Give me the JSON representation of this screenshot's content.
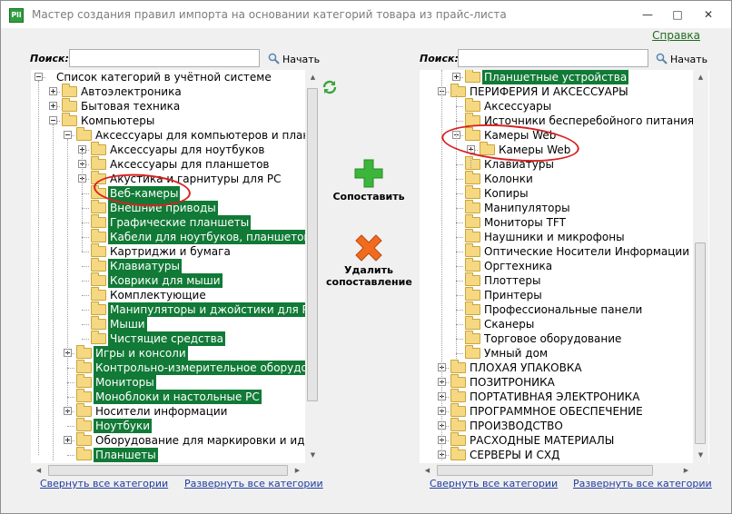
{
  "window": {
    "title": "Мастер создания правил импорта на основании категорий товара из прайс-листа",
    "icon_text": "Pli",
    "help_label": "Справка"
  },
  "left": {
    "search_label": "Поиск:",
    "search_value": "",
    "start_label": "Начать",
    "collapse_label": "Свернуть все категории",
    "expand_label": "Развернуть все категории",
    "rows": [
      {
        "label": "Список категорий в учётной системе",
        "level": 0,
        "exp": "minus",
        "folder": false,
        "hl": false
      },
      {
        "label": "Автоэлектроника",
        "level": 1,
        "exp": "plus",
        "folder": true,
        "hl": false
      },
      {
        "label": "Бытовая техника",
        "level": 1,
        "exp": "plus",
        "folder": true,
        "hl": false
      },
      {
        "label": "Компьютеры",
        "level": 1,
        "exp": "minus",
        "folder": true,
        "hl": false
      },
      {
        "label": "Аксессуары для компьютеров и планшетов",
        "level": 2,
        "exp": "minus",
        "folder": true,
        "hl": false
      },
      {
        "label": "Аксессуары для ноутбуков",
        "level": 3,
        "exp": "plus",
        "folder": true,
        "hl": false
      },
      {
        "label": "Аксессуары для планшетов",
        "level": 3,
        "exp": "plus",
        "folder": true,
        "hl": false
      },
      {
        "label": "Акустика и гарнитуры для РС",
        "level": 3,
        "exp": "plus",
        "folder": true,
        "hl": false
      },
      {
        "label": "Веб-камеры",
        "level": 3,
        "exp": "",
        "folder": true,
        "hl": true
      },
      {
        "label": "Внешние приводы",
        "level": 3,
        "exp": "",
        "folder": true,
        "hl": true
      },
      {
        "label": "Графические планшеты",
        "level": 3,
        "exp": "",
        "folder": true,
        "hl": true
      },
      {
        "label": "Кабели для ноутбуков, планшетов и",
        "level": 3,
        "exp": "",
        "folder": true,
        "hl": true
      },
      {
        "label": "Картриджи и бумага",
        "level": 3,
        "exp": "",
        "folder": true,
        "hl": false
      },
      {
        "label": "Клавиатуры",
        "level": 3,
        "exp": "",
        "folder": true,
        "hl": true
      },
      {
        "label": "Коврики для мыши",
        "level": 3,
        "exp": "",
        "folder": true,
        "hl": true
      },
      {
        "label": "Комплектующие",
        "level": 3,
        "exp": "",
        "folder": true,
        "hl": false
      },
      {
        "label": "Манипуляторы и джойстики для РС",
        "level": 3,
        "exp": "",
        "folder": true,
        "hl": true
      },
      {
        "label": "Мыши",
        "level": 3,
        "exp": "",
        "folder": true,
        "hl": true
      },
      {
        "label": "Чистящие средства",
        "level": 3,
        "exp": "",
        "folder": true,
        "hl": true
      },
      {
        "label": "Игры и консоли",
        "level": 2,
        "exp": "plus",
        "folder": true,
        "hl": true
      },
      {
        "label": "Контрольно-измерительное оборудова",
        "level": 2,
        "exp": "",
        "folder": true,
        "hl": true
      },
      {
        "label": "Мониторы",
        "level": 2,
        "exp": "",
        "folder": true,
        "hl": true
      },
      {
        "label": "Моноблоки и настольные РС",
        "level": 2,
        "exp": "",
        "folder": true,
        "hl": true
      },
      {
        "label": "Носители информации",
        "level": 2,
        "exp": "plus",
        "folder": true,
        "hl": false
      },
      {
        "label": "Ноутбуки",
        "level": 2,
        "exp": "",
        "folder": true,
        "hl": true
      },
      {
        "label": "Оборудование для маркировки и идент",
        "level": 2,
        "exp": "plus",
        "folder": true,
        "hl": false
      },
      {
        "label": "Планшеты",
        "level": 2,
        "exp": "",
        "folder": true,
        "hl": true
      }
    ]
  },
  "middle": {
    "match_label": "Сопоставить",
    "delete_label_1": "Удалить",
    "delete_label_2": "сопоставление"
  },
  "right": {
    "search_label": "Поиск:",
    "search_value": "",
    "start_label": "Начать",
    "collapse_label": "Свернуть все категории",
    "expand_label": "Развернуть все категории",
    "rows": [
      {
        "label": "Планшетные устройства",
        "level": 1,
        "exp": "plus",
        "folder": true,
        "hl": true
      },
      {
        "label": "ПЕРИФЕРИЯ И АКСЕССУАРЫ",
        "level": 0,
        "exp": "minus",
        "folder": true,
        "hl": false
      },
      {
        "label": "Аксессуары",
        "level": 1,
        "exp": "",
        "folder": true,
        "hl": false
      },
      {
        "label": "Источники бесперебойного питания",
        "level": 1,
        "exp": "",
        "folder": true,
        "hl": false
      },
      {
        "label": "Камеры Web",
        "level": 1,
        "exp": "minus",
        "folder": true,
        "hl": false
      },
      {
        "label": "Камеры Web",
        "level": 2,
        "exp": "plus",
        "folder": true,
        "hl": false
      },
      {
        "label": "Клавиатуры",
        "level": 1,
        "exp": "",
        "folder": true,
        "hl": false
      },
      {
        "label": "Колонки",
        "level": 1,
        "exp": "",
        "folder": true,
        "hl": false
      },
      {
        "label": "Копиры",
        "level": 1,
        "exp": "",
        "folder": true,
        "hl": false
      },
      {
        "label": "Манипуляторы",
        "level": 1,
        "exp": "",
        "folder": true,
        "hl": false
      },
      {
        "label": "Мониторы TFT",
        "level": 1,
        "exp": "",
        "folder": true,
        "hl": false
      },
      {
        "label": "Наушники и микрофоны",
        "level": 1,
        "exp": "",
        "folder": true,
        "hl": false
      },
      {
        "label": "Оптические Носители Информации",
        "level": 1,
        "exp": "",
        "folder": true,
        "hl": false
      },
      {
        "label": "Оргтехника",
        "level": 1,
        "exp": "",
        "folder": true,
        "hl": false
      },
      {
        "label": "Плоттеры",
        "level": 1,
        "exp": "",
        "folder": true,
        "hl": false
      },
      {
        "label": "Принтеры",
        "level": 1,
        "exp": "",
        "folder": true,
        "hl": false
      },
      {
        "label": "Профессиональные панели",
        "level": 1,
        "exp": "",
        "folder": true,
        "hl": false
      },
      {
        "label": "Сканеры",
        "level": 1,
        "exp": "",
        "folder": true,
        "hl": false
      },
      {
        "label": "Торговое оборудование",
        "level": 1,
        "exp": "",
        "folder": true,
        "hl": false
      },
      {
        "label": "Умный дом",
        "level": 1,
        "exp": "",
        "folder": true,
        "hl": false
      },
      {
        "label": "ПЛОХАЯ УПАКОВКА",
        "level": 0,
        "exp": "plus",
        "folder": true,
        "hl": false
      },
      {
        "label": "ПОЗИТРОНИКА",
        "level": 0,
        "exp": "plus",
        "folder": true,
        "hl": false
      },
      {
        "label": "ПОРТАТИВНАЯ ЭЛЕКТРОНИКА",
        "level": 0,
        "exp": "plus",
        "folder": true,
        "hl": false
      },
      {
        "label": "ПРОГРАММНОЕ ОБЕСПЕЧЕНИЕ",
        "level": 0,
        "exp": "plus",
        "folder": true,
        "hl": false
      },
      {
        "label": "ПРОИЗВОДСТВО",
        "level": 0,
        "exp": "plus",
        "folder": true,
        "hl": false
      },
      {
        "label": "РАСХОДНЫЕ МАТЕРИАЛЫ",
        "level": 0,
        "exp": "plus",
        "folder": true,
        "hl": false
      },
      {
        "label": "СЕРВЕРЫ И СХД",
        "level": 0,
        "exp": "plus",
        "folder": true,
        "hl": false
      }
    ]
  },
  "colors": {
    "highlight": "#117a36",
    "annotation": "#d92020",
    "link": "#1f3c9e"
  }
}
